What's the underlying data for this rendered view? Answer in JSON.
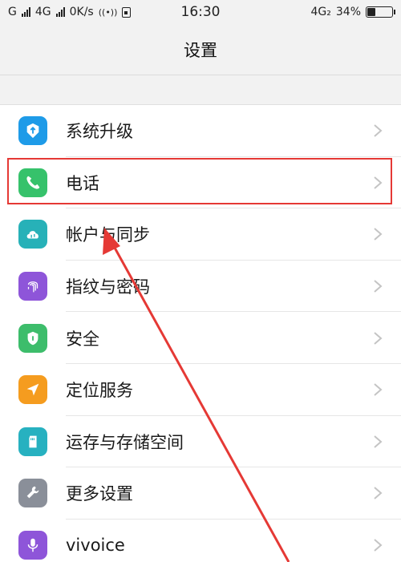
{
  "status_bar": {
    "carrier1": "G",
    "carrier2": "4G",
    "net_speed": "0K/s",
    "time": "16:30",
    "network": "4G₂",
    "battery": "34%",
    "battery_level": 0.34
  },
  "header": {
    "title": "设置"
  },
  "settings": {
    "items": [
      {
        "label": "系统升级",
        "icon": "system-update-icon",
        "color": "#1e9be8"
      },
      {
        "label": "电话",
        "icon": "phone-icon",
        "color": "#36c26b"
      },
      {
        "label": "帐户与同步",
        "icon": "cloud-sync-icon",
        "color": "#27b1b8"
      },
      {
        "label": "指纹与密码",
        "icon": "fingerprint-icon",
        "color": "#8e55d9"
      },
      {
        "label": "安全",
        "icon": "shield-icon",
        "color": "#3dbd6b"
      },
      {
        "label": "定位服务",
        "icon": "location-icon",
        "color": "#f59c1f"
      },
      {
        "label": "运存与存储空间",
        "icon": "storage-icon",
        "color": "#27b1c0"
      },
      {
        "label": "更多设置",
        "icon": "wrench-icon",
        "color": "#8a8f99"
      },
      {
        "label": "vivoice",
        "icon": "microphone-icon",
        "color": "#8e55d9"
      }
    ]
  },
  "annotation": {
    "highlight_color": "#e53935"
  }
}
